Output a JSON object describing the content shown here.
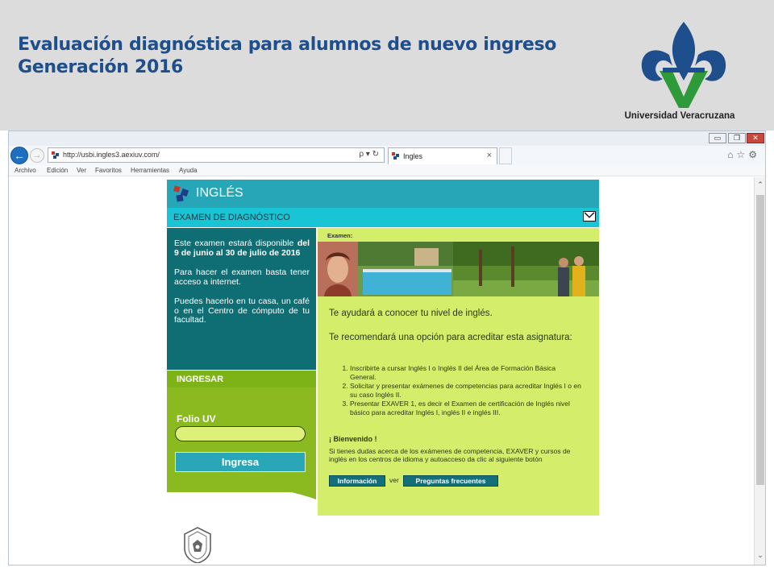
{
  "slide": {
    "title_line1": "Evaluación diagnóstica para alumnos de nuevo ingreso",
    "title_line2": "Generación 2016",
    "university_name": "Universidad Veracruzana",
    "colors": {
      "title": "#1f4e8c",
      "logo_blue": "#1f4e8c",
      "logo_green": "#2e9a3a"
    }
  },
  "browser": {
    "window_buttons": {
      "minimize": "▭",
      "restore": "❐",
      "close": "✕"
    },
    "back_icon": "←",
    "forward_icon": "→",
    "address": "http://usbi.ingles3.aexiuv.com/",
    "address_tools": "ρ ▾ ↻",
    "tab_label": "Ingles",
    "tab_close": "×",
    "right_icons": "⌂☆⚙",
    "menu": [
      "Archivo",
      "Edición",
      "Ver",
      "Favoritos",
      "Herramientas",
      "Ayuda"
    ],
    "scroll_up": "⌃",
    "scroll_down": "⌄"
  },
  "site": {
    "header_title": "INGLÉS",
    "exam_bar_title": "EXAMEN DE DIAGNÓSTICO",
    "left_panel": {
      "p1_text": "Este examen estará disponible",
      "p1_bold": "del 9 de junio al 30 de julio de 2016",
      "p2": "Para hacer el examen basta tener acceso a internet.",
      "p3": "Puedes hacerlo en tu casa, un café o en el Centro de cómputo de tu facultad."
    },
    "login": {
      "header": "INGRESAR",
      "folio_label": "Folio UV",
      "folio_value": "",
      "button": "Ingresa"
    },
    "right_panel": {
      "examen_label": "Examen:",
      "intro": "Te ayudará a conocer tu nivel de inglés.",
      "recommend": "Te recomendará una opción para acreditar esta asignatura:",
      "options": [
        "Inscribirte a cursar Inglés I o Inglés II del Área de Formación Básica General.",
        "Solicitar y presentar exámenes de competencias para acreditar Inglés I o en su caso Inglés II.",
        "Presentar EXAVER 1, es decir el Examen de certificación de Inglés nivel básico para acreditar Inglés I, inglés II e inglés III."
      ],
      "welcome": "¡ Bienvenido !",
      "doubts": "Si tienes dudas acerca de los exámenes de competencia, EXAVER y cursos de inglés en los centros de idioma y autoacceso da clic al siguiente botón",
      "info_button": "Información",
      "ver_text": "ver",
      "faq_button": "Preguntas frecuentes"
    },
    "colors": {
      "header": "#27a6b8",
      "exam_bar": "#19c4d4",
      "left_panel": "#0f6e74",
      "login_green": "#8ab920",
      "right_panel": "#d4ee6c"
    }
  }
}
